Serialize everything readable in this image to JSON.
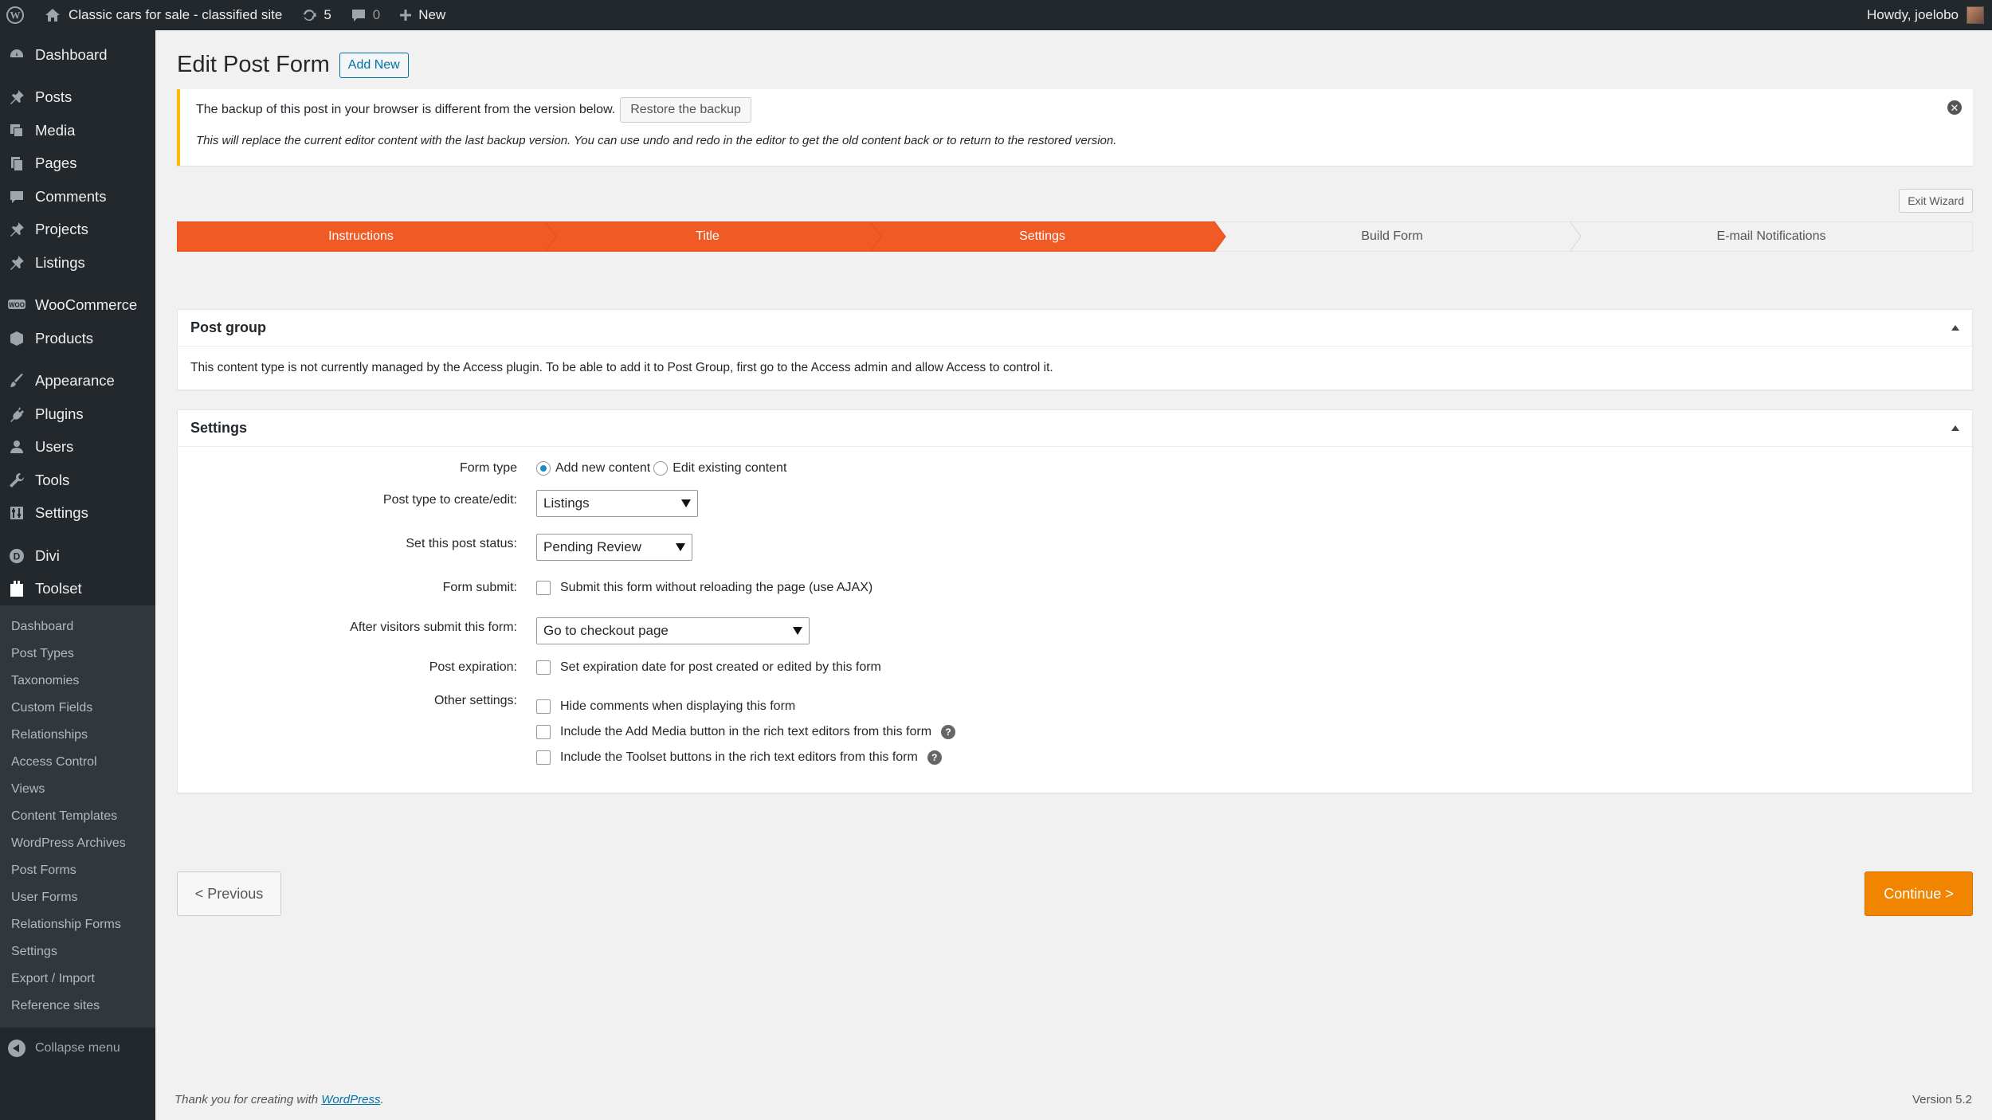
{
  "admin_bar": {
    "site_name": "Classic cars for sale - classified site",
    "updates_count": "5",
    "comments_count": "0",
    "new_label": "New",
    "greeting": "Howdy, joelobo"
  },
  "sidebar": {
    "items": [
      {
        "label": "Dashboard",
        "icon": "dashboard-icon"
      },
      {
        "label": "Posts",
        "icon": "pin-icon"
      },
      {
        "label": "Media",
        "icon": "media-icon"
      },
      {
        "label": "Pages",
        "icon": "pages-icon"
      },
      {
        "label": "Comments",
        "icon": "comment-icon"
      },
      {
        "label": "Projects",
        "icon": "pin-icon"
      },
      {
        "label": "Listings",
        "icon": "pin-icon"
      },
      {
        "label": "WooCommerce",
        "icon": "woocommerce-icon"
      },
      {
        "label": "Products",
        "icon": "products-icon"
      },
      {
        "label": "Appearance",
        "icon": "brush-icon"
      },
      {
        "label": "Plugins",
        "icon": "plug-icon"
      },
      {
        "label": "Users",
        "icon": "user-icon"
      },
      {
        "label": "Tools",
        "icon": "wrench-icon"
      },
      {
        "label": "Settings",
        "icon": "settings-icon"
      },
      {
        "label": "Divi",
        "icon": "divi-icon"
      },
      {
        "label": "Toolset",
        "icon": "toolset-icon"
      }
    ],
    "toolset_submenu": [
      "Dashboard",
      "Post Types",
      "Taxonomies",
      "Custom Fields",
      "Relationships",
      "Access Control",
      "Views",
      "Content Templates",
      "WordPress Archives",
      "Post Forms",
      "User Forms",
      "Relationship Forms",
      "Settings",
      "Export / Import",
      "Reference sites"
    ],
    "collapse_label": "Collapse menu"
  },
  "page": {
    "title": "Edit Post Form",
    "add_new_label": "Add New"
  },
  "notice": {
    "message": "The backup of this post in your browser is different from the version below.",
    "restore_label": "Restore the backup",
    "detail": "This will replace the current editor content with the last backup version. You can use undo and redo in the editor to get the old content back or to return to the restored version.",
    "dismiss_glyph": "✕"
  },
  "wizard": {
    "exit_label": "Exit Wizard",
    "steps": [
      {
        "label": "Instructions",
        "completed": true
      },
      {
        "label": "Title",
        "completed": true
      },
      {
        "label": "Settings",
        "completed": true
      },
      {
        "label": "Build Form",
        "completed": false
      },
      {
        "label": "E-mail Notifications",
        "completed": false
      }
    ],
    "active_color": "#f05a24",
    "inactive_color": "#f1f1f1"
  },
  "post_group": {
    "title": "Post group",
    "text": "This content type is not currently managed by the Access plugin. To be able to add it to Post Group, first go to the Access admin and allow Access to control it."
  },
  "settings": {
    "title": "Settings",
    "form_type": {
      "label": "Form type",
      "option_new": "Add new content",
      "option_edit": "Edit existing content",
      "selected": "Add new content"
    },
    "post_type": {
      "label": "Post type to create/edit:",
      "value": "Listings"
    },
    "post_status": {
      "label": "Set this post status:",
      "value": "Pending Review"
    },
    "form_submit": {
      "label": "Form submit:",
      "option": "Submit this form without reloading the page (use AJAX)",
      "checked": false
    },
    "after_submit": {
      "label": "After visitors submit this form:",
      "value": "Go to checkout page"
    },
    "post_expiration": {
      "label": "Post expiration:",
      "option": "Set expiration date for post created or edited by this form",
      "checked": false
    },
    "other_settings": {
      "label": "Other settings:",
      "options": [
        {
          "text": "Hide comments when displaying this form",
          "checked": false,
          "help": false
        },
        {
          "text": "Include the Add Media button in the rich text editors from this form",
          "checked": false,
          "help": true
        },
        {
          "text": "Include the Toolset buttons in the rich text editors from this form",
          "checked": false,
          "help": true
        }
      ]
    },
    "help_glyph": "?"
  },
  "navigation": {
    "previous_label": "< Previous",
    "continue_label": "Continue >",
    "continue_color": "#f18500"
  },
  "footer": {
    "thanks_prefix": "Thank you for creating with",
    "thanks_link": "WordPress",
    "thanks_suffix": ".",
    "version": "Version 5.2"
  }
}
